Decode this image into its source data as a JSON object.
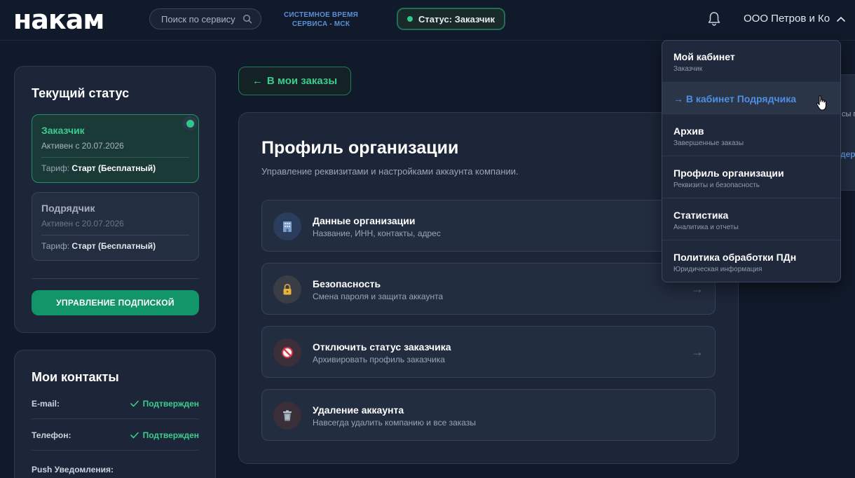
{
  "header": {
    "logo": "накам",
    "search_placeholder": "Поиск по сервису",
    "system_time_line1": "СИСТЕМНОЕ ВРЕМЯ",
    "system_time_line2": "СЕРВИСА - МСК",
    "status": "Статус: Заказчик",
    "account_name": "ООО Петров и Ко"
  },
  "status_card": {
    "title": "Текущий статус",
    "roles": [
      {
        "name": "Заказчик",
        "since": "Активен с 20.07.2026",
        "tariff_label": "Тариф:",
        "tariff_value": "Старт (Бесплатный)"
      },
      {
        "name": "Подрядчик",
        "since": "Активен с 20.07.2026",
        "tariff_label": "Тариф:",
        "tariff_value": "Старт (Бесплатный)"
      }
    ],
    "subscription_button": "УПРАВЛЕНИЕ ПОДПИСКОЙ"
  },
  "contacts_card": {
    "title": "Мои контакты",
    "rows": [
      {
        "label": "E-mail:",
        "status": "Подтвержден"
      },
      {
        "label": "Телефон:",
        "status": "Подтвержден"
      },
      {
        "label": "Push Уведомления:",
        "status": ""
      }
    ]
  },
  "main": {
    "back_button": "В мои заказы",
    "back_arrow": "←",
    "profile_title": "Профиль организации",
    "profile_subtitle": "Управление реквизитами и настройками аккаунта компании.",
    "options": [
      {
        "title": "Данные организации",
        "desc": "Название, ИНН, контакты, адрес",
        "icon": "building-icon"
      },
      {
        "title": "Безопасность",
        "desc": "Смена пароля и защита аккаунта",
        "icon": "lock-icon"
      },
      {
        "title": "Отключить статус заказчика",
        "desc": "Архивировать профиль заказчика",
        "icon": "no-entry-icon"
      },
      {
        "title": "Удаление аккаунта",
        "desc": "Навсегда удалить компанию и все заказы",
        "icon": "trash-icon"
      }
    ],
    "option_arrow": "→"
  },
  "right_peek": {
    "text1": "сы г",
    "text2": "дер"
  },
  "dropdown": {
    "items": [
      {
        "title": "Мой кабинет",
        "sub": "Заказчик"
      },
      {
        "title": "→ В кабинет Подрядчика",
        "sub": ""
      },
      {
        "title": "Архив",
        "sub": "Завершенные заказы"
      },
      {
        "title": "Профиль организации",
        "sub": "Реквизиты и безопасность"
      },
      {
        "title": "Статистика",
        "sub": "Аналитика и отчеты"
      },
      {
        "title": "Политика обработки ПДн",
        "sub": "Юридическая информация"
      }
    ]
  },
  "colors": {
    "background": "#111a2a",
    "card": "#1c2638",
    "accent_green": "#3ccc8d",
    "button_green": "#13956a",
    "link_blue": "#4f8fe3"
  }
}
